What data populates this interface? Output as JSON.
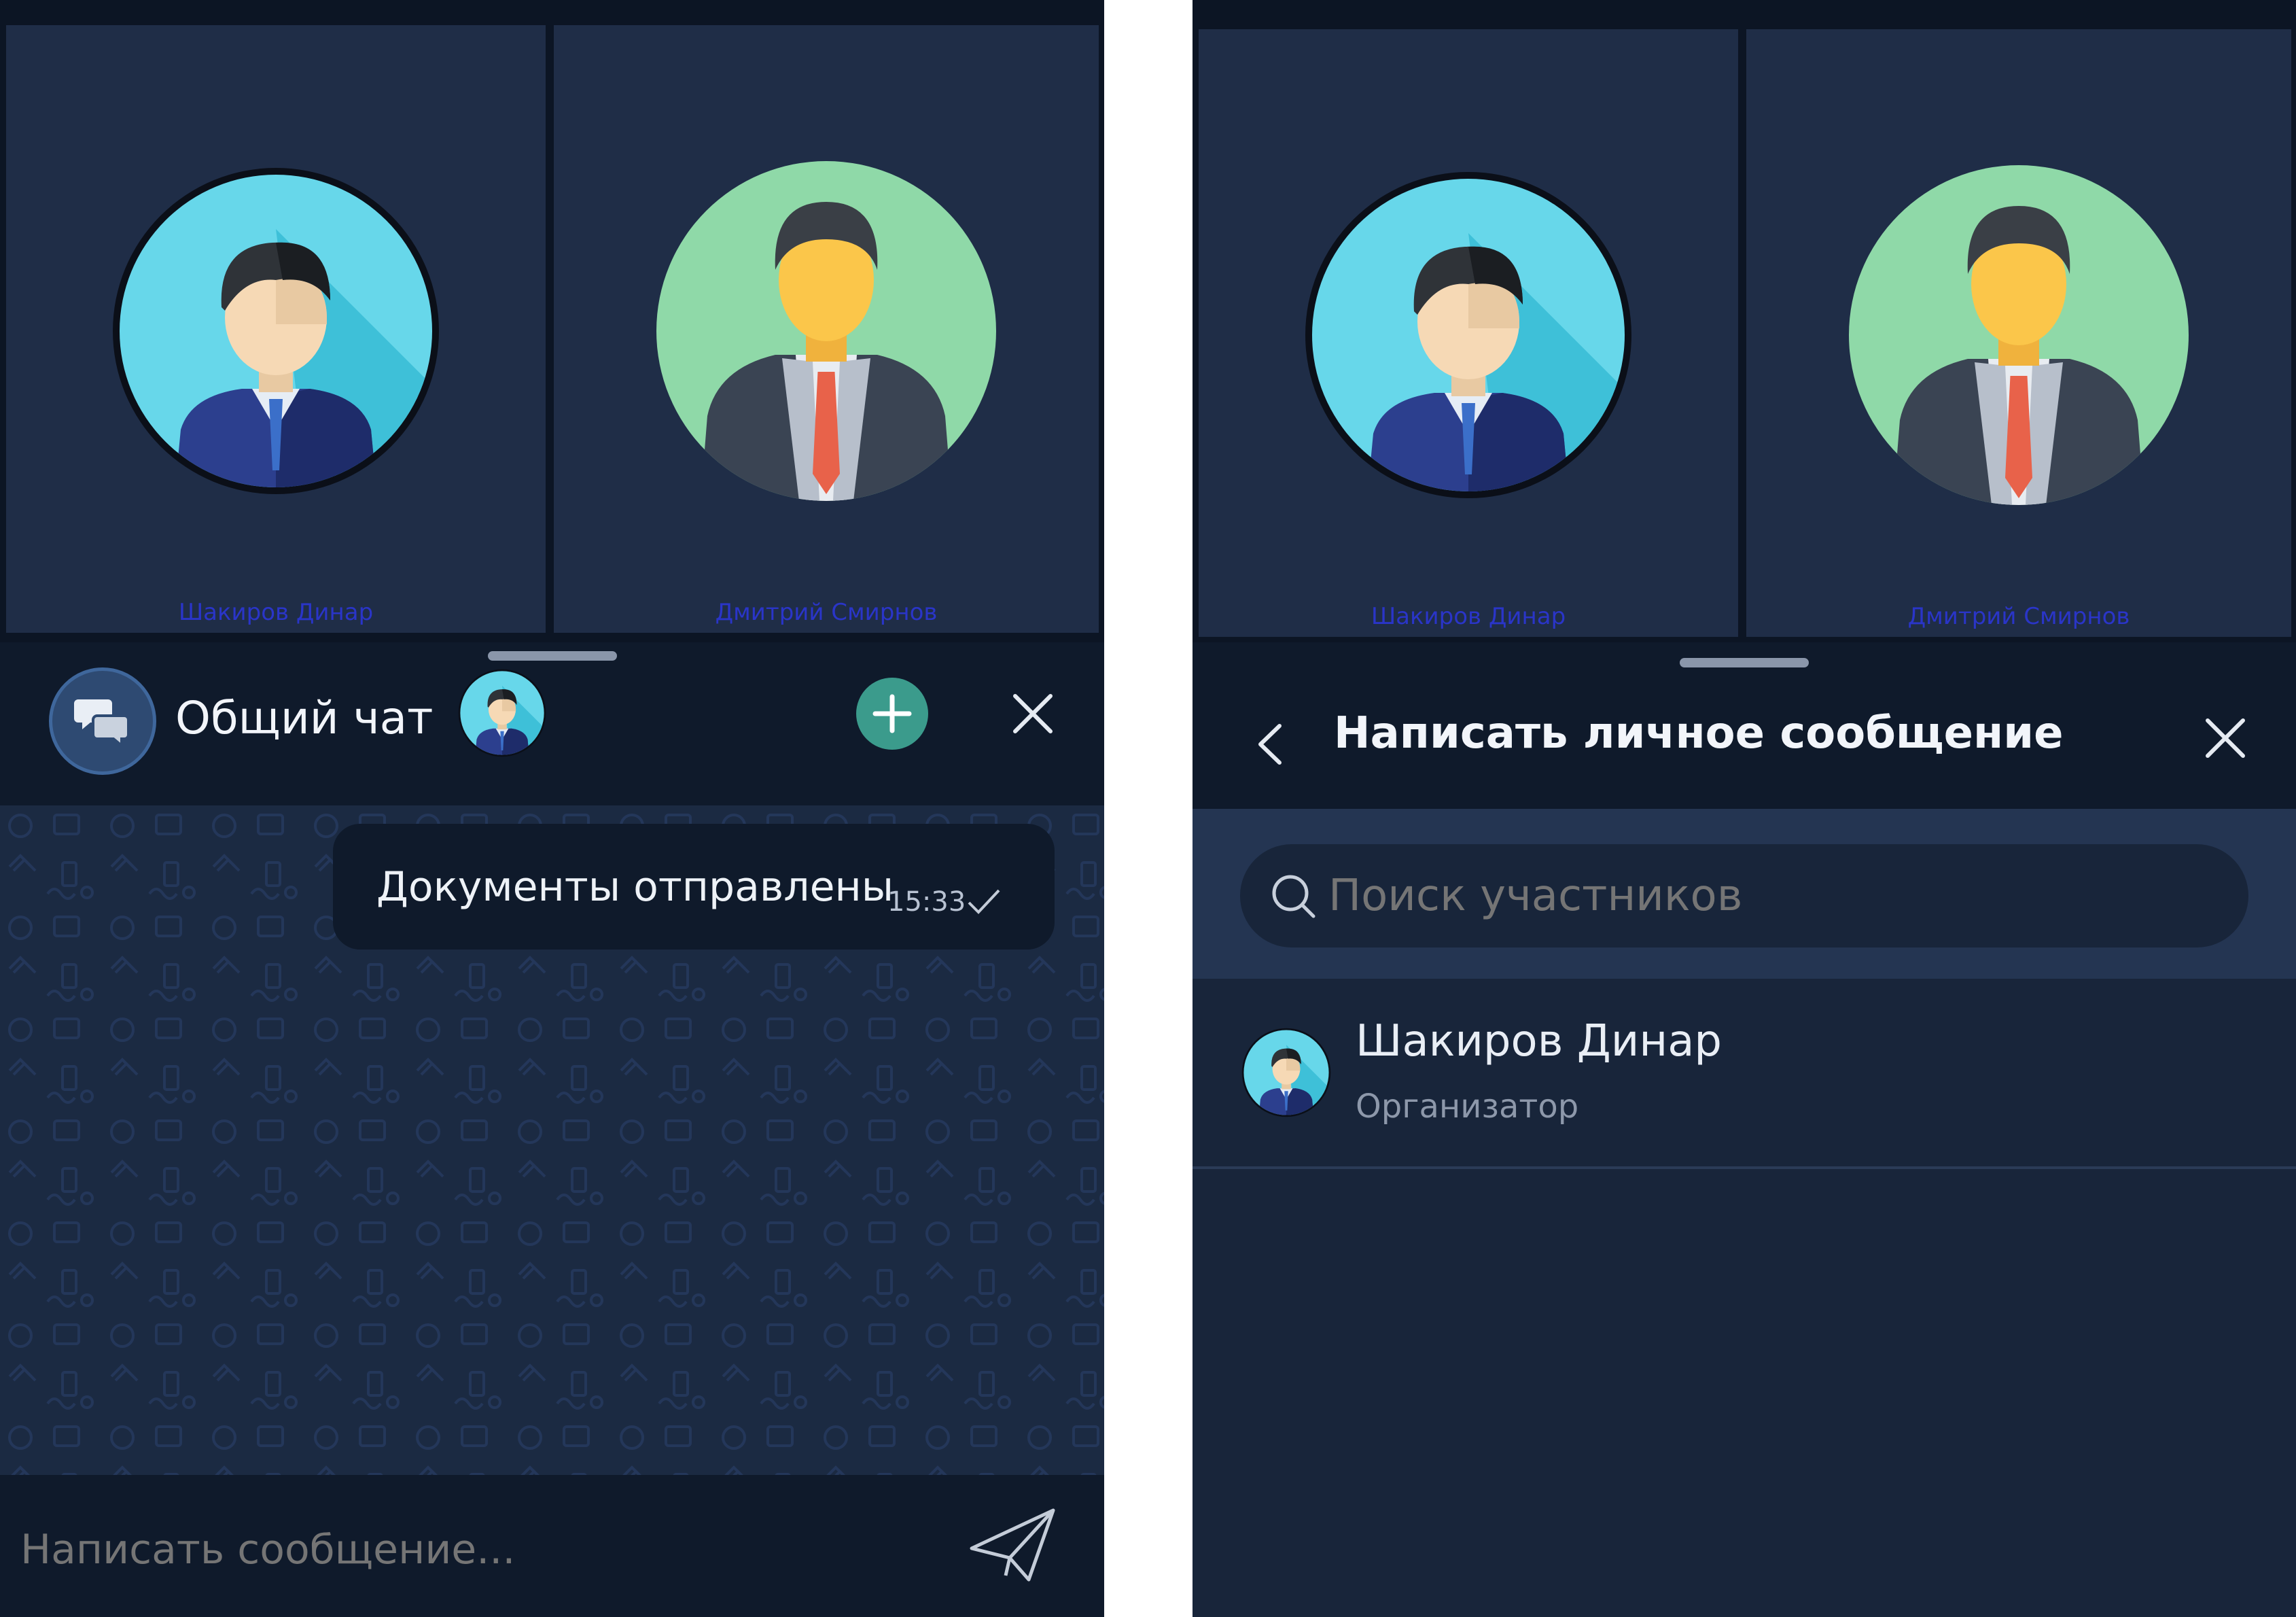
{
  "left_panel": {
    "participants": [
      {
        "name": "Шакиров Динар",
        "avatar_icon": "businessman-blue-avatar"
      },
      {
        "name": "Дмитрий Смирнов",
        "avatar_icon": "businessman-green-avatar"
      }
    ],
    "header": {
      "chat_icon": "chat-bubbles-icon",
      "title": "Общий чат",
      "avatar_icon": "businessman-blue-avatar",
      "add_icon": "plus-icon",
      "close_icon": "close-icon"
    },
    "message": {
      "text": "Документы отправлены",
      "time": "15:33",
      "status_icon": "check-icon"
    },
    "input": {
      "placeholder": "Написать сообщение...",
      "send_icon": "send-icon"
    }
  },
  "right_panel": {
    "participants": [
      {
        "name": "Шакиров Динар",
        "avatar_icon": "businessman-blue-avatar"
      },
      {
        "name": "Дмитрий Смирнов",
        "avatar_icon": "businessman-green-avatar"
      }
    ],
    "header": {
      "back_icon": "chevron-left-icon",
      "title": "Написать личное сообщение",
      "close_icon": "close-icon"
    },
    "search": {
      "placeholder": "Поиск участников",
      "icon": "search-icon"
    },
    "list": [
      {
        "name": "Шакиров Динар",
        "role": "Организатор",
        "avatar_icon": "businessman-blue-avatar"
      }
    ]
  },
  "colors": {
    "background": "#0f1a2b",
    "tile": "#1f2d47",
    "accent_green": "#3b9b8c",
    "avatar_blue": "#5fd3e8",
    "avatar_green": "#8fd9a8",
    "tie_red": "#e8624a"
  }
}
